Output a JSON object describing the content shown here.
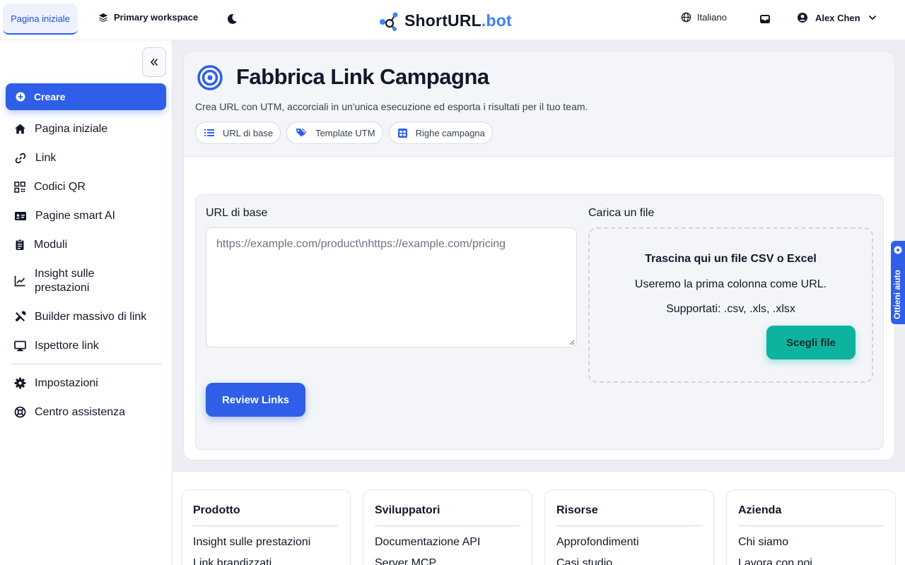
{
  "topbar": {
    "home_label": "Pagina iniziale",
    "workspace_label": "Primary workspace",
    "logo_name": "ShortURL",
    "logo_suffix": ".bot",
    "language_label": "Italiano",
    "user_name": "Alex Chen"
  },
  "sidebar": {
    "create_label": "Creare",
    "items": [
      {
        "label": "Pagina iniziale",
        "icon": "home-icon"
      },
      {
        "label": "Link",
        "icon": "link-icon"
      },
      {
        "label": "Codici QR",
        "icon": "qr-code-icon"
      },
      {
        "label": "Pagine smart AI",
        "icon": "id-card-icon"
      },
      {
        "label": "Moduli",
        "icon": "clipboard-icon"
      },
      {
        "label": "Insight sulle prestazioni",
        "icon": "chart-line-icon"
      },
      {
        "label": "Builder massivo di link",
        "icon": "tools-icon"
      },
      {
        "label": "Ispettore link",
        "icon": "monitor-icon"
      }
    ],
    "bottom_items": [
      {
        "label": "Impostazioni",
        "icon": "gear-icon"
      },
      {
        "label": "Centro assistenza",
        "icon": "lifebuoy-icon"
      }
    ]
  },
  "main": {
    "title": "Fabbrica Link Campagna",
    "subtitle": "Crea URL con UTM, accorciali in un'unica esecuzione ed esporta i risultati per il tuo team.",
    "pills": [
      {
        "label": "URL di base",
        "icon": "list-icon"
      },
      {
        "label": "Template UTM",
        "icon": "tags-icon"
      },
      {
        "label": "Righe campagna",
        "icon": "table-icon"
      }
    ],
    "form": {
      "base_url_label": "URL di base",
      "base_url_placeholder": "https://example.com/product\\nhttps://example.com/pricing",
      "upload_label": "Carica un file",
      "drop_title": "Trascina qui un file CSV o Excel",
      "drop_line1": "Useremo la prima colonna come URL.",
      "drop_line2": "Supportati: .csv, .xls, .xlsx",
      "choose_file_label": "Scegli file",
      "review_label": "Review Links"
    }
  },
  "help_tab": {
    "label": "Ottieni aiuto"
  },
  "footer": {
    "columns": [
      {
        "title": "Prodotto",
        "links": [
          "Insight sulle prestazioni",
          "Link brandizzati"
        ]
      },
      {
        "title": "Sviluppatori",
        "links": [
          "Documentazione API",
          "Server MCP"
        ]
      },
      {
        "title": "Risorse",
        "links": [
          "Approfondimenti",
          "Casi studio"
        ]
      },
      {
        "title": "Azienda",
        "links": [
          "Chi siamo",
          "Lavora con noi"
        ]
      }
    ]
  },
  "colors": {
    "accent": "#2f5fe8",
    "teal": "#0eb3a0",
    "logo_blue": "#3b82f6"
  }
}
